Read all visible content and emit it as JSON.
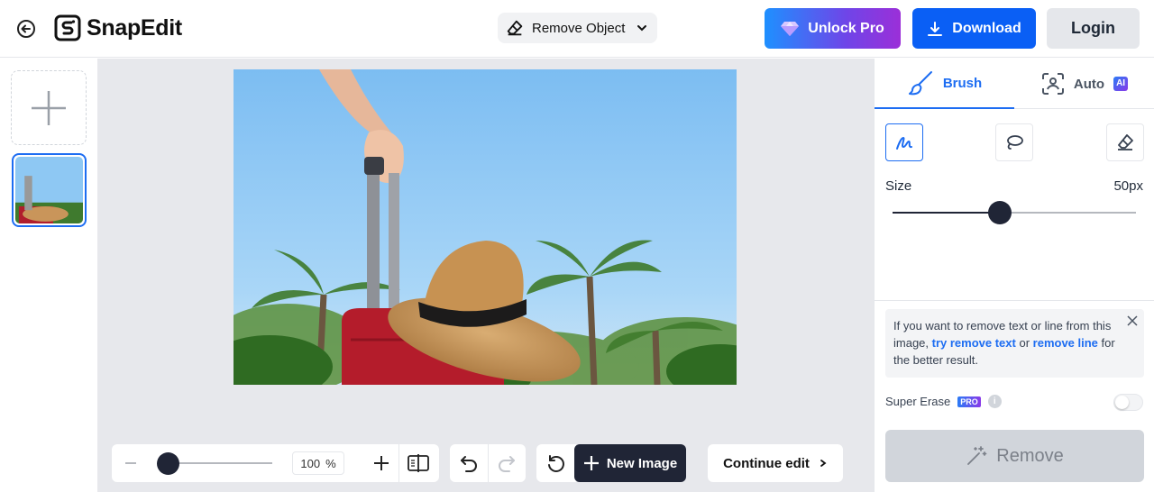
{
  "header": {
    "brand": "SnapEdit",
    "tool_select": "Remove Object",
    "unlock_label": "Unlock Pro",
    "download_label": "Download",
    "login_label": "Login"
  },
  "toolbar": {
    "zoom_value": "100",
    "zoom_unit": "%",
    "new_image_label": "New Image",
    "continue_label": "Continue edit"
  },
  "panel": {
    "tabs": [
      {
        "label": "Brush",
        "active": true
      },
      {
        "label": "Auto",
        "badge": "AI",
        "active": false
      }
    ],
    "size_label": "Size",
    "size_value": "50px",
    "size_slider_fraction": 0.44,
    "tip": {
      "text_1": "If you want to remove text or line from this image, ",
      "link_1": "try remove text",
      "text_2": " or ",
      "link_2": "remove line",
      "text_3": " for the better result."
    },
    "super_erase_label": "Super Erase",
    "pro_badge": "PRO",
    "super_erase_on": false,
    "remove_label": "Remove"
  },
  "colors": {
    "accent": "#1d6df2",
    "download": "#0a5ff5",
    "dark": "#202536",
    "canvas_bg": "#e7e8ec"
  },
  "icons": [
    "back-arrow-icon",
    "snapedit-logo-icon",
    "eraser-icon",
    "chevron-down-icon",
    "gem-icon",
    "download-icon",
    "plus-icon",
    "minus-icon",
    "compare-icon",
    "undo-icon",
    "redo-icon",
    "reset-icon",
    "chevron-right-icon",
    "brush-icon",
    "scan-face-icon",
    "brush-stroke-icon",
    "lasso-icon",
    "eraser-mode-icon",
    "close-icon",
    "info-icon",
    "magic-wand-icon"
  ]
}
